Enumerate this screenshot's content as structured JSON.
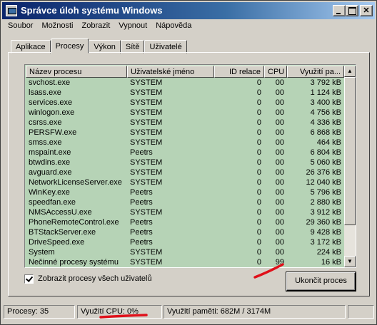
{
  "window": {
    "title": "Správce úloh systému Windows"
  },
  "menu": [
    "Soubor",
    "Možnosti",
    "Zobrazit",
    "Vypnout",
    "Nápověda"
  ],
  "tabs": [
    "Aplikace",
    "Procesy",
    "Výkon",
    "Sítě",
    "Uživatelé"
  ],
  "active_tab": "Procesy",
  "columns": {
    "name": "Název procesu",
    "user": "Uživatelské jméno",
    "id": "ID relace",
    "cpu": "CPU",
    "mem": "Využití pa..."
  },
  "processes": [
    {
      "name": "svchost.exe",
      "user": "SYSTEM",
      "id": "0",
      "cpu": "00",
      "mem": "3 792 kB"
    },
    {
      "name": "lsass.exe",
      "user": "SYSTEM",
      "id": "0",
      "cpu": "00",
      "mem": "1 124 kB"
    },
    {
      "name": "services.exe",
      "user": "SYSTEM",
      "id": "0",
      "cpu": "00",
      "mem": "3 400 kB"
    },
    {
      "name": "winlogon.exe",
      "user": "SYSTEM",
      "id": "0",
      "cpu": "00",
      "mem": "4 756 kB"
    },
    {
      "name": "csrss.exe",
      "user": "SYSTEM",
      "id": "0",
      "cpu": "00",
      "mem": "4 336 kB"
    },
    {
      "name": "PERSFW.exe",
      "user": "SYSTEM",
      "id": "0",
      "cpu": "00",
      "mem": "6 868 kB"
    },
    {
      "name": "smss.exe",
      "user": "SYSTEM",
      "id": "0",
      "cpu": "00",
      "mem": "464 kB"
    },
    {
      "name": "mspaint.exe",
      "user": "Peetrs",
      "id": "0",
      "cpu": "00",
      "mem": "6 804 kB"
    },
    {
      "name": "btwdins.exe",
      "user": "SYSTEM",
      "id": "0",
      "cpu": "00",
      "mem": "5 060 kB"
    },
    {
      "name": "avguard.exe",
      "user": "SYSTEM",
      "id": "0",
      "cpu": "00",
      "mem": "26 376 kB"
    },
    {
      "name": "NetworkLicenseServer.exe",
      "user": "SYSTEM",
      "id": "0",
      "cpu": "00",
      "mem": "12 040 kB"
    },
    {
      "name": "WinKey.exe",
      "user": "Peetrs",
      "id": "0",
      "cpu": "00",
      "mem": "5 796 kB"
    },
    {
      "name": "speedfan.exe",
      "user": "Peetrs",
      "id": "0",
      "cpu": "00",
      "mem": "2 880 kB"
    },
    {
      "name": "NMSAccessU.exe",
      "user": "SYSTEM",
      "id": "0",
      "cpu": "00",
      "mem": "3 912 kB"
    },
    {
      "name": "PhoneRemoteControl.exe",
      "user": "Peetrs",
      "id": "0",
      "cpu": "00",
      "mem": "29 360 kB"
    },
    {
      "name": "BTStackServer.exe",
      "user": "Peetrs",
      "id": "0",
      "cpu": "00",
      "mem": "9 428 kB"
    },
    {
      "name": "DriveSpeed.exe",
      "user": "Peetrs",
      "id": "0",
      "cpu": "00",
      "mem": "3 172 kB"
    },
    {
      "name": "System",
      "user": "SYSTEM",
      "id": "0",
      "cpu": "00",
      "mem": "224 kB"
    },
    {
      "name": "Nečinné procesy systému",
      "user": "SYSTEM",
      "id": "0",
      "cpu": "99",
      "mem": "16 kB"
    }
  ],
  "show_all_users": {
    "label": "Zobrazit procesy všech uživatelů",
    "checked": true
  },
  "end_process_label": "Ukončit proces",
  "status": {
    "processes": "Procesy: 35",
    "cpu": "Využití CPU: 0%",
    "memory": "Využití paměti: 682M / 3174M"
  },
  "colors": {
    "list_background": "#b6d3b6",
    "marker": "#e0101a",
    "titlebar": "#0a246a"
  }
}
